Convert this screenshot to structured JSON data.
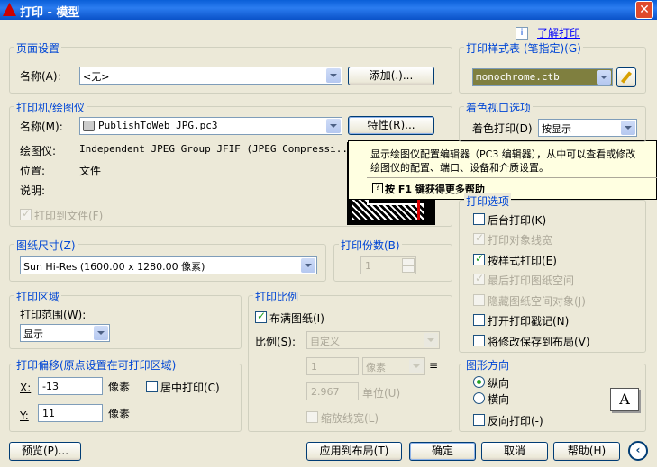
{
  "window": {
    "title": "打印 - 模型",
    "close": "✕"
  },
  "help_link": "了解打印",
  "page_setup": {
    "legend": "页面设置",
    "name_label": "名称(A):",
    "name_value": "<无>",
    "add_button": "添加(.)..."
  },
  "printer": {
    "legend": "打印机/绘图仪",
    "name_label": "名称(M):",
    "name_value": "PublishToWeb JPG.pc3",
    "properties_button": "特性(R)...",
    "plotter_label": "绘图仪:",
    "plotter_value": "Independent JPEG Group JFIF (JPEG Compressi...",
    "location_label": "位置:",
    "location_value": "文件",
    "description_label": "说明:",
    "print_to_file": "打印到文件(F)"
  },
  "tooltip": {
    "text_line1": "显示绘图仪配置编辑器（PC3 编辑器），从中可以查看或修改",
    "text_line2": "绘图仪的配置、端口、设备和介质设置。",
    "help_text": "按 F1 键获得更多帮助",
    "help_mark": "?"
  },
  "paper_size": {
    "legend": "图纸尺寸(Z)",
    "value": "Sun Hi-Res (1600.00 x 1280.00 像素)"
  },
  "copies": {
    "legend": "打印份数(B)",
    "value": "1"
  },
  "plot_area": {
    "legend": "打印区域",
    "range_label": "打印范围(W):",
    "range_value": "显示"
  },
  "plot_offset": {
    "legend": "打印偏移(原点设置在可打印区域)",
    "x_label": "X:",
    "x_value": "-13",
    "x_unit": "像素",
    "y_label": "Y:",
    "y_value": "11",
    "y_unit": "像素",
    "center_label": "居中打印(C)"
  },
  "plot_scale": {
    "legend": "打印比例",
    "fit_label": "布满图纸(I)",
    "scale_label": "比例(S):",
    "scale_value": "自定义",
    "value1": "1",
    "unit1": "像素",
    "eq": "≡",
    "value2": "2.967",
    "unit2": "单位(U)",
    "lineweights_label": "缩放线宽(L)"
  },
  "style_table": {
    "legend": "打印样式表 (笔指定)(G)",
    "value": "monochrome.ctb"
  },
  "shaded_viewport": {
    "legend": "着色视口选项",
    "shade_label": "着色打印(D)",
    "shade_value": "按显示"
  },
  "plot_options": {
    "legend": "打印选项",
    "items": [
      {
        "label": "后台打印(K)",
        "checked": false,
        "disabled": false
      },
      {
        "label": "打印对象线宽",
        "checked": true,
        "disabled": true
      },
      {
        "label": "按样式打印(E)",
        "checked": true,
        "disabled": false
      },
      {
        "label": "最后打印图纸空间",
        "checked": true,
        "disabled": true
      },
      {
        "label": "隐藏图纸空间对象(J)",
        "checked": false,
        "disabled": true
      },
      {
        "label": "打开打印戳记(N)",
        "checked": false,
        "disabled": false
      },
      {
        "label": "将修改保存到布局(V)",
        "checked": false,
        "disabled": false
      }
    ]
  },
  "orientation": {
    "legend": "图形方向",
    "portrait": "纵向",
    "landscape": "横向",
    "upside_down": "反向打印(-)",
    "icon_letter": "A"
  },
  "footer": {
    "preview": "预览(P)...",
    "apply": "应用到布局(T)",
    "ok": "确定",
    "cancel": "取消",
    "help": "帮助(H)"
  }
}
